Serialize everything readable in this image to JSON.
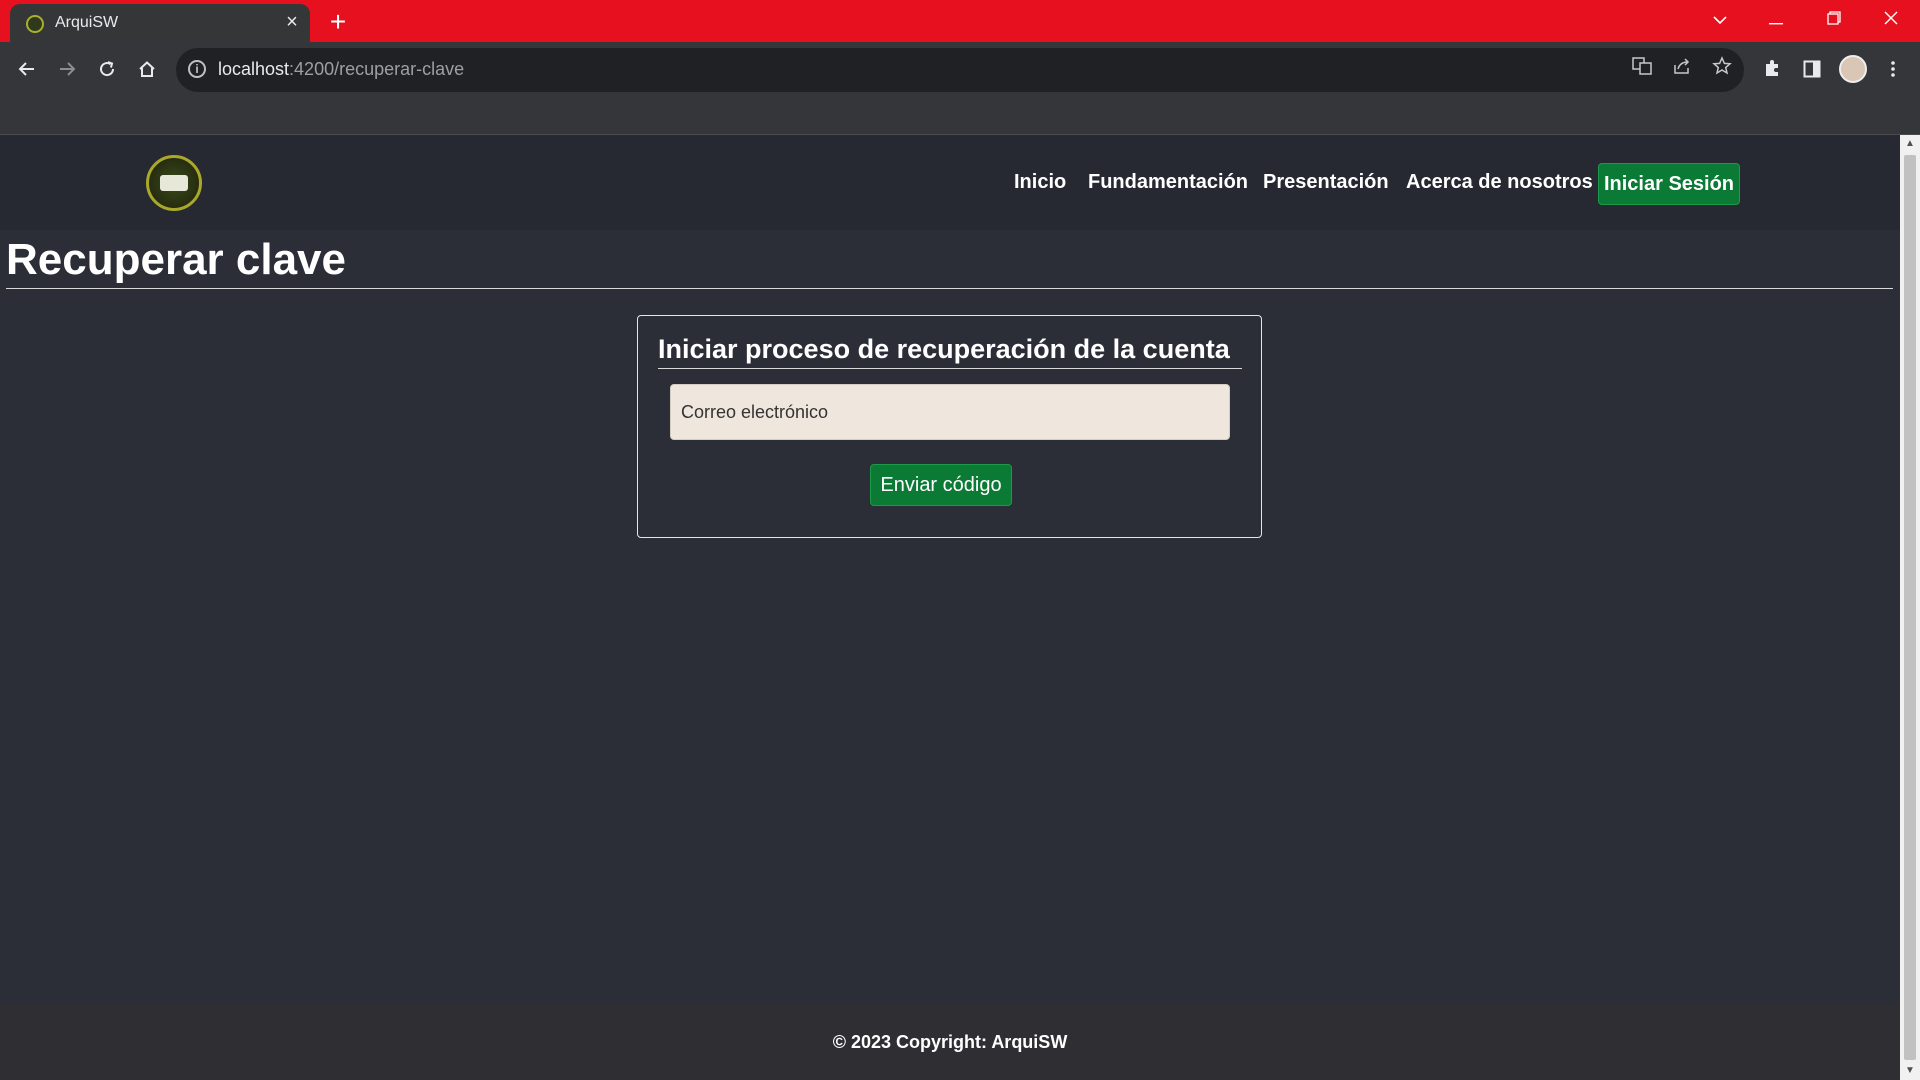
{
  "browser": {
    "tab_title": "ArquiSW",
    "tab_close_glyph": "×",
    "new_tab_glyph": "+",
    "url_host": "localhost",
    "url_path": ":4200/recuperar-clave",
    "tab_strip_color": "#e6101f"
  },
  "navbar": {
    "links": [
      "Inicio",
      "Fundamentación",
      "Presentación",
      "Acerca de nosotros"
    ],
    "login_label": "Iniciar Sesión"
  },
  "page": {
    "title": "Recuperar clave"
  },
  "card": {
    "title": "Iniciar proceso de recuperación de la cuenta",
    "email_placeholder": "Correo electrónico",
    "send_label": "Enviar código"
  },
  "footer": {
    "text": "© 2023 Copyright: ArquiSW"
  },
  "theme": {
    "accent_green": "#0b7a35",
    "page_background": "#2b2d37",
    "input_background": "#efe7dd"
  },
  "icons": {
    "back": "arrow-left-icon",
    "forward": "arrow-right-icon",
    "reload": "reload-icon",
    "home": "home-icon",
    "info": "info-icon",
    "translate": "translate-icon",
    "share": "share-icon",
    "bookmark": "star-icon",
    "extensions": "puzzle-icon",
    "sidepanel": "side-panel-icon",
    "menu": "kebab-menu-icon"
  }
}
